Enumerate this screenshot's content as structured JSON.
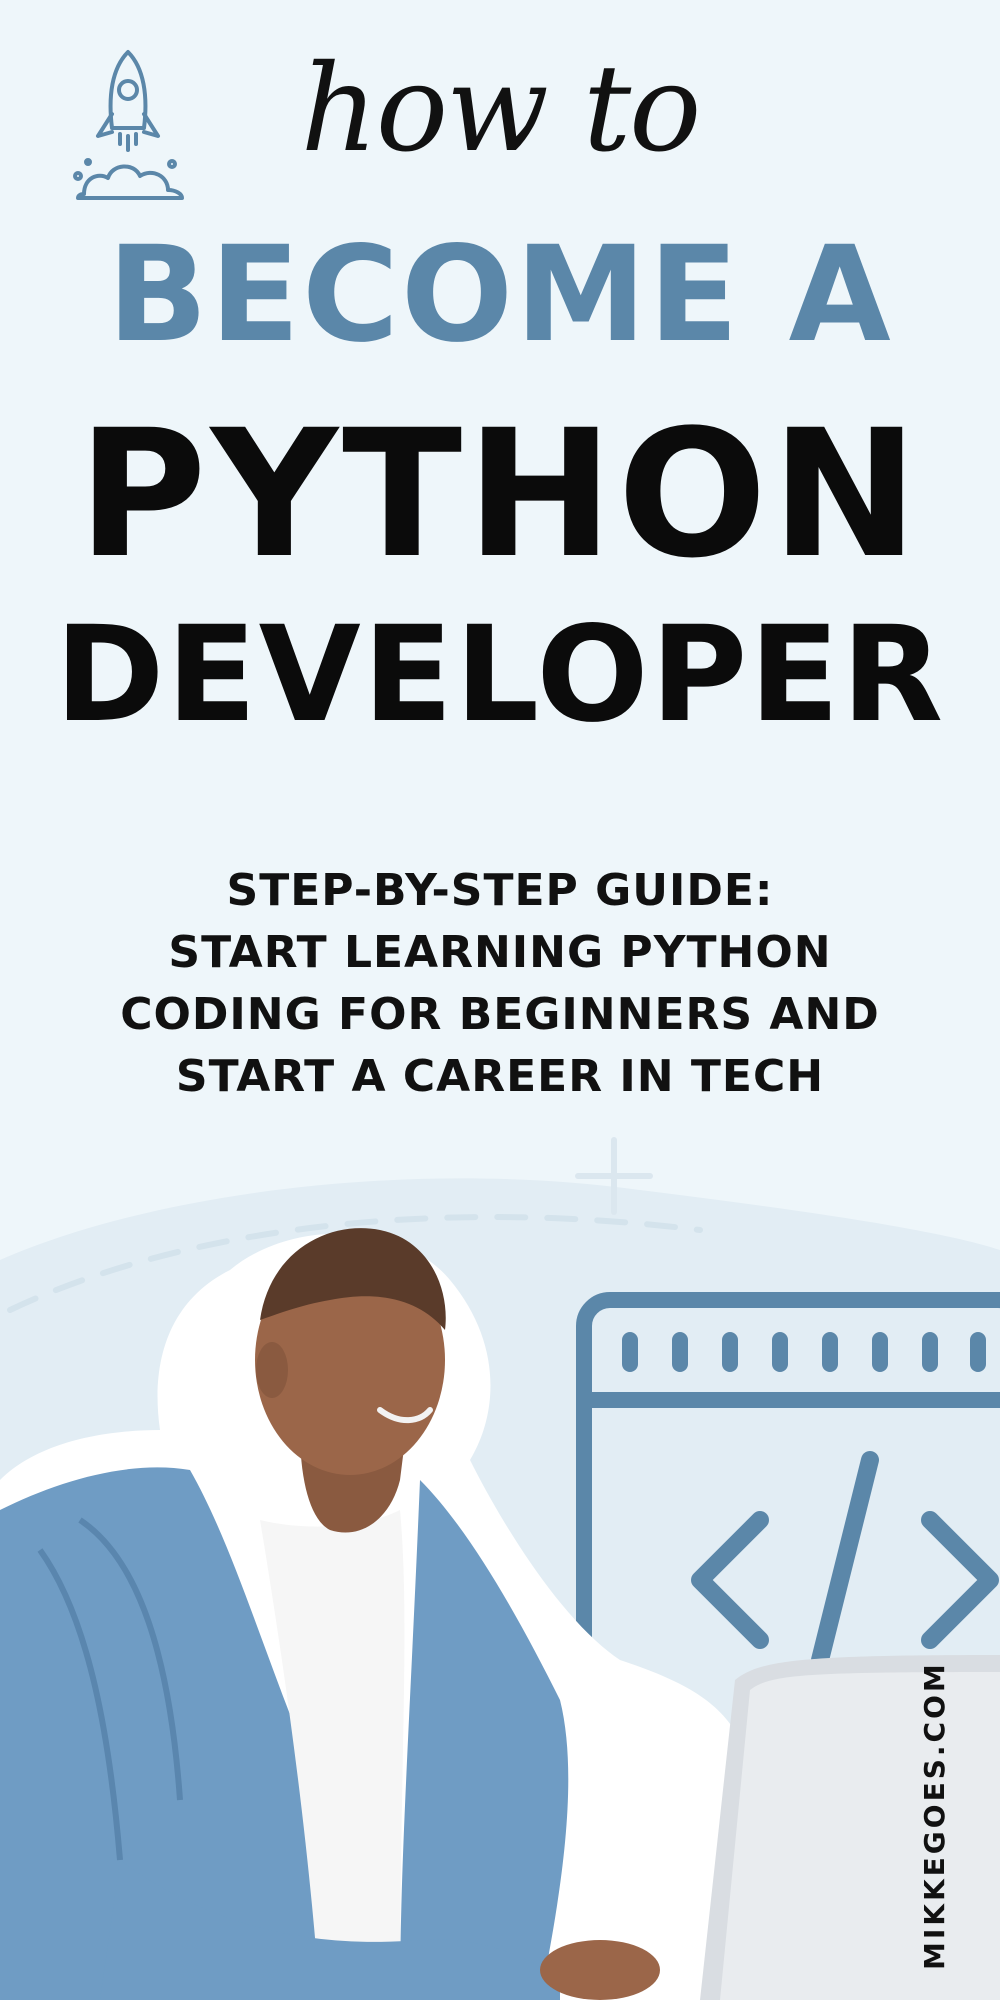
{
  "title": {
    "script": "how to",
    "line1": "BECOME A",
    "line2": "PYTHON",
    "line3": "DEVELOPER"
  },
  "subtitle": [
    "STEP-BY-STEP GUIDE:",
    "START LEARNING PYTHON",
    "CODING FOR BEGINNERS AND",
    "START A CAREER IN TECH"
  ],
  "footer": {
    "domain": "MIKKEGOES.COM"
  },
  "icons": [
    "rocket-icon",
    "code-window-icon",
    "code-brackets-icon",
    "plus-icon"
  ],
  "colors": {
    "background": "#eef6fa",
    "accent": "#5b87a9",
    "text": "#0b0b0b"
  }
}
